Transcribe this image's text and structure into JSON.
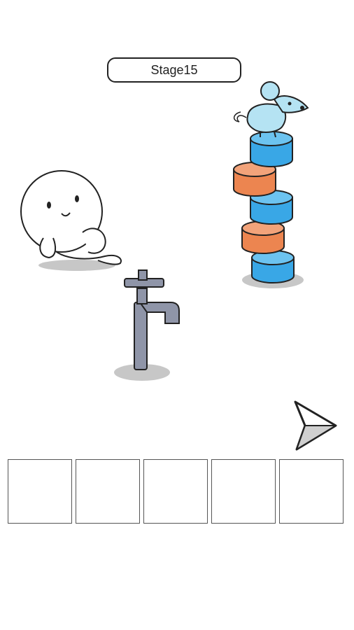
{
  "header": {
    "stage_label": "Stage15"
  },
  "scene": {
    "objects": [
      "ghost-character",
      "water-faucet",
      "cylinder-stack",
      "mouse"
    ],
    "colors": {
      "blue": "#39a7e6",
      "orange": "#ec8550",
      "mouse": "#b5e3f3",
      "faucet": "#8f95a8"
    }
  },
  "controls": {
    "next_icon": "arrow-right-icon"
  },
  "inventory": {
    "slot_count": 5
  }
}
